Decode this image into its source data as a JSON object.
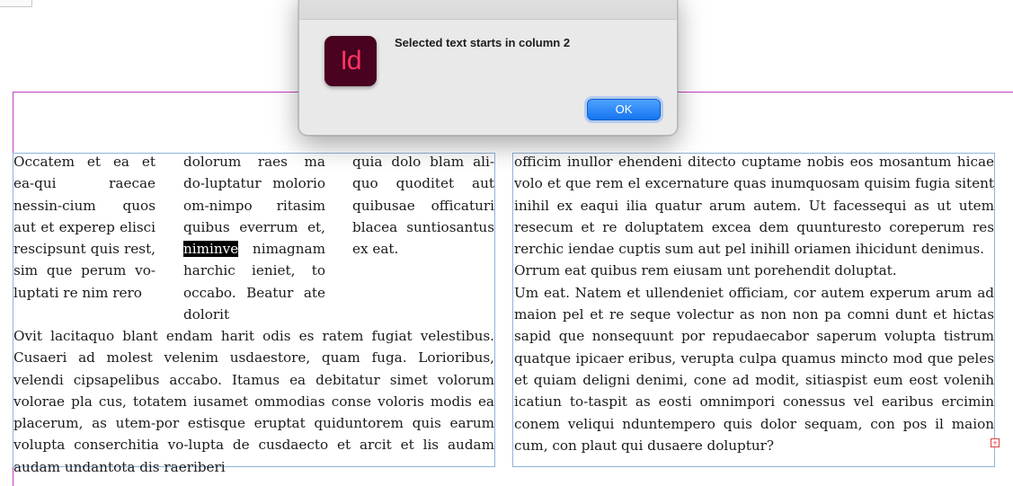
{
  "dialog": {
    "message": "Selected text starts in column 2",
    "app_icon_text": "Id",
    "ok_label": "OK",
    "accent_color": "#1574f0",
    "app_icon_bg": "#49021f"
  },
  "columns": {
    "col1": "Occatem et ea et ea-qui raecae nessin-cium quos aut et experep elisci rescipsunt quis rest, sim que perum vo-luptati re nim rero",
    "col2_before": "dolorum raes ma do-luptatur molorio om-nimpo ritasim quibus everrum et, ",
    "col2_selected": "niminve",
    "col2_after": " nimagnam harchic ieniet, to occabo. Beatur ate dolorit",
    "col3": "quia dolo blam ali-quo quoditet aut quibusae officaturi blacea suntiosantus ex eat."
  },
  "left_paragraph": "Ovit lacitaquo blant endam harit odis es ratem fugiat velestibus. Cusaeri ad molest velenim usdaestore, quam fuga. Lorioribus, velendi cipsapelibus accabo. Itamus ea debitatur simet volorum volorae pla cus, totatem iusamet ommodias conse voloris modis ea placerum, as utem-por estisque eruptat quiduntorem quis earum volupta conserchitia vo-lupta de cusdaecto et arcit et lis audam audam undantota dis raeriberi",
  "right_paragraphs": [
    "officim inullor ehendeni ditecto cuptame nobis eos mosantum hicae volo et que rem el excernature quas inumquosam quisim fugia sitent inihil ex eaqui ilia quatur arum autem. Ut facessequi as ut utem resecum et re doluptatem excea dem quunturesto coreperum res rerchic iendae cuptis sum aut pel inihill oriamen ihicidunt denimus.",
    "Orrum eat quibus rem eiusam unt porehendit doluptat.",
    "Um eat. Natem et ullendeniet officiam, cor autem experum arum ad maion pel et re seque volectur as non non pa comni dunt et hictas sapid que nonsequunt por repudaecabor saperum volupta tistrum quatque ipicaer eribus, verupta culpa quamus mincto mod que peles et quiam deligni denimi, cone ad modit, sitiaspist eum eost volenih icatiun to-taspit as eosti omnimpori conessus vel earibus ercimin conem veliqui nduntempero quis dolor sequam, con pos il maion cum, con plaut qui dusaere doluptur?"
  ]
}
